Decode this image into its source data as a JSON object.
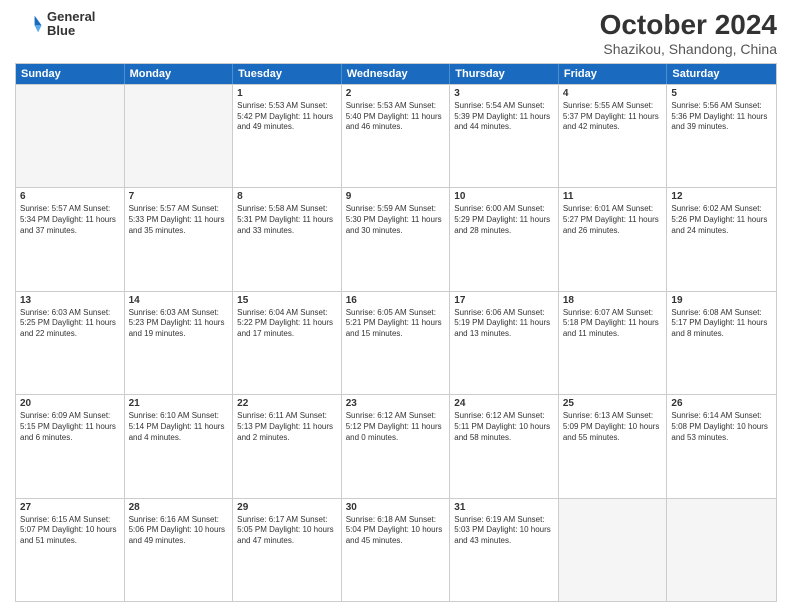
{
  "logo": {
    "line1": "General",
    "line2": "Blue"
  },
  "title": "October 2024",
  "subtitle": "Shazikou, Shandong, China",
  "weekdays": [
    "Sunday",
    "Monday",
    "Tuesday",
    "Wednesday",
    "Thursday",
    "Friday",
    "Saturday"
  ],
  "weeks": [
    [
      {
        "day": "",
        "text": ""
      },
      {
        "day": "",
        "text": ""
      },
      {
        "day": "1",
        "text": "Sunrise: 5:53 AM\nSunset: 5:42 PM\nDaylight: 11 hours and 49 minutes."
      },
      {
        "day": "2",
        "text": "Sunrise: 5:53 AM\nSunset: 5:40 PM\nDaylight: 11 hours and 46 minutes."
      },
      {
        "day": "3",
        "text": "Sunrise: 5:54 AM\nSunset: 5:39 PM\nDaylight: 11 hours and 44 minutes."
      },
      {
        "day": "4",
        "text": "Sunrise: 5:55 AM\nSunset: 5:37 PM\nDaylight: 11 hours and 42 minutes."
      },
      {
        "day": "5",
        "text": "Sunrise: 5:56 AM\nSunset: 5:36 PM\nDaylight: 11 hours and 39 minutes."
      }
    ],
    [
      {
        "day": "6",
        "text": "Sunrise: 5:57 AM\nSunset: 5:34 PM\nDaylight: 11 hours and 37 minutes."
      },
      {
        "day": "7",
        "text": "Sunrise: 5:57 AM\nSunset: 5:33 PM\nDaylight: 11 hours and 35 minutes."
      },
      {
        "day": "8",
        "text": "Sunrise: 5:58 AM\nSunset: 5:31 PM\nDaylight: 11 hours and 33 minutes."
      },
      {
        "day": "9",
        "text": "Sunrise: 5:59 AM\nSunset: 5:30 PM\nDaylight: 11 hours and 30 minutes."
      },
      {
        "day": "10",
        "text": "Sunrise: 6:00 AM\nSunset: 5:29 PM\nDaylight: 11 hours and 28 minutes."
      },
      {
        "day": "11",
        "text": "Sunrise: 6:01 AM\nSunset: 5:27 PM\nDaylight: 11 hours and 26 minutes."
      },
      {
        "day": "12",
        "text": "Sunrise: 6:02 AM\nSunset: 5:26 PM\nDaylight: 11 hours and 24 minutes."
      }
    ],
    [
      {
        "day": "13",
        "text": "Sunrise: 6:03 AM\nSunset: 5:25 PM\nDaylight: 11 hours and 22 minutes."
      },
      {
        "day": "14",
        "text": "Sunrise: 6:03 AM\nSunset: 5:23 PM\nDaylight: 11 hours and 19 minutes."
      },
      {
        "day": "15",
        "text": "Sunrise: 6:04 AM\nSunset: 5:22 PM\nDaylight: 11 hours and 17 minutes."
      },
      {
        "day": "16",
        "text": "Sunrise: 6:05 AM\nSunset: 5:21 PM\nDaylight: 11 hours and 15 minutes."
      },
      {
        "day": "17",
        "text": "Sunrise: 6:06 AM\nSunset: 5:19 PM\nDaylight: 11 hours and 13 minutes."
      },
      {
        "day": "18",
        "text": "Sunrise: 6:07 AM\nSunset: 5:18 PM\nDaylight: 11 hours and 11 minutes."
      },
      {
        "day": "19",
        "text": "Sunrise: 6:08 AM\nSunset: 5:17 PM\nDaylight: 11 hours and 8 minutes."
      }
    ],
    [
      {
        "day": "20",
        "text": "Sunrise: 6:09 AM\nSunset: 5:15 PM\nDaylight: 11 hours and 6 minutes."
      },
      {
        "day": "21",
        "text": "Sunrise: 6:10 AM\nSunset: 5:14 PM\nDaylight: 11 hours and 4 minutes."
      },
      {
        "day": "22",
        "text": "Sunrise: 6:11 AM\nSunset: 5:13 PM\nDaylight: 11 hours and 2 minutes."
      },
      {
        "day": "23",
        "text": "Sunrise: 6:12 AM\nSunset: 5:12 PM\nDaylight: 11 hours and 0 minutes."
      },
      {
        "day": "24",
        "text": "Sunrise: 6:12 AM\nSunset: 5:11 PM\nDaylight: 10 hours and 58 minutes."
      },
      {
        "day": "25",
        "text": "Sunrise: 6:13 AM\nSunset: 5:09 PM\nDaylight: 10 hours and 55 minutes."
      },
      {
        "day": "26",
        "text": "Sunrise: 6:14 AM\nSunset: 5:08 PM\nDaylight: 10 hours and 53 minutes."
      }
    ],
    [
      {
        "day": "27",
        "text": "Sunrise: 6:15 AM\nSunset: 5:07 PM\nDaylight: 10 hours and 51 minutes."
      },
      {
        "day": "28",
        "text": "Sunrise: 6:16 AM\nSunset: 5:06 PM\nDaylight: 10 hours and 49 minutes."
      },
      {
        "day": "29",
        "text": "Sunrise: 6:17 AM\nSunset: 5:05 PM\nDaylight: 10 hours and 47 minutes."
      },
      {
        "day": "30",
        "text": "Sunrise: 6:18 AM\nSunset: 5:04 PM\nDaylight: 10 hours and 45 minutes."
      },
      {
        "day": "31",
        "text": "Sunrise: 6:19 AM\nSunset: 5:03 PM\nDaylight: 10 hours and 43 minutes."
      },
      {
        "day": "",
        "text": ""
      },
      {
        "day": "",
        "text": ""
      }
    ]
  ]
}
